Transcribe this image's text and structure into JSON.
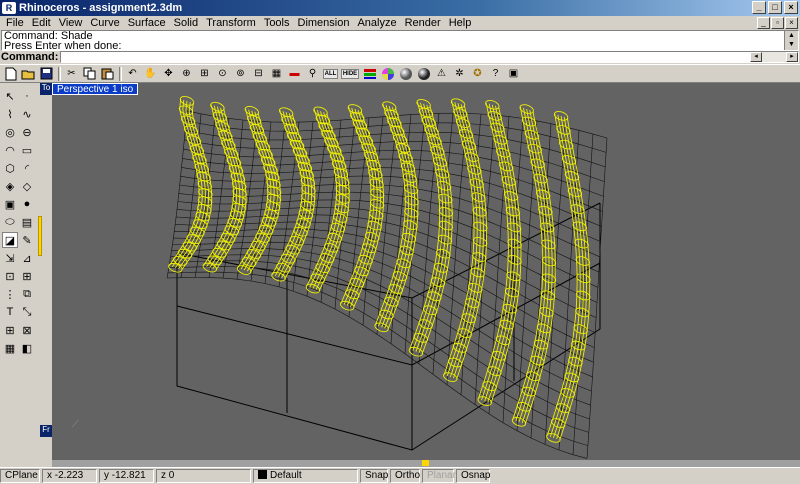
{
  "window": {
    "title": "Rhinoceros - assignment2.3dm",
    "buttons": [
      "_",
      "□",
      "×"
    ]
  },
  "menu": {
    "items": [
      "File",
      "Edit",
      "View",
      "Curve",
      "Surface",
      "Solid",
      "Transform",
      "Tools",
      "Dimension",
      "Analyze",
      "Render",
      "Help"
    ]
  },
  "command_history": {
    "lines": [
      "Command: Shade",
      "Press Enter when done:"
    ]
  },
  "command_prompt": {
    "label": "Command:",
    "value": ""
  },
  "toolbar": {
    "icons": [
      "new-icon",
      "open-icon",
      "save-icon",
      "cut-icon",
      "copy-icon",
      "paste-icon",
      "undo-icon",
      "pan-icon",
      "rotate-view-icon",
      "zoom-icon",
      "zoom-window-icon",
      "zoom-extents-icon",
      "zoom-selected-icon",
      "viewport-layout-icon",
      "grid-icon",
      "car-icon",
      "show-icon",
      "hide-icon",
      "layer-icon",
      "color-wheel-icon",
      "shade-sphere-icon",
      "render-icon",
      "light-icon",
      "settings-icon",
      "help-icon",
      "properties-icon"
    ],
    "all_label": "ALL",
    "hide_label": "HIDE"
  },
  "viewport": {
    "title": "Perspective 1 iso",
    "top_tab": "To",
    "bottom_tab": "Fr"
  },
  "status": {
    "cplane": "CPlane",
    "x": "x -2.223",
    "y": "y -12.821",
    "z": "z 0",
    "layer": "Default",
    "snap": "Snap",
    "ortho": "Ortho",
    "planar": "Planar",
    "osnap": "Osnap"
  },
  "colors": {
    "viewport_bg": "#636363",
    "wireframe_tubes": "#f0f000",
    "wireframe_mesh": "#000000",
    "title_blue": "#0a3cc8"
  }
}
